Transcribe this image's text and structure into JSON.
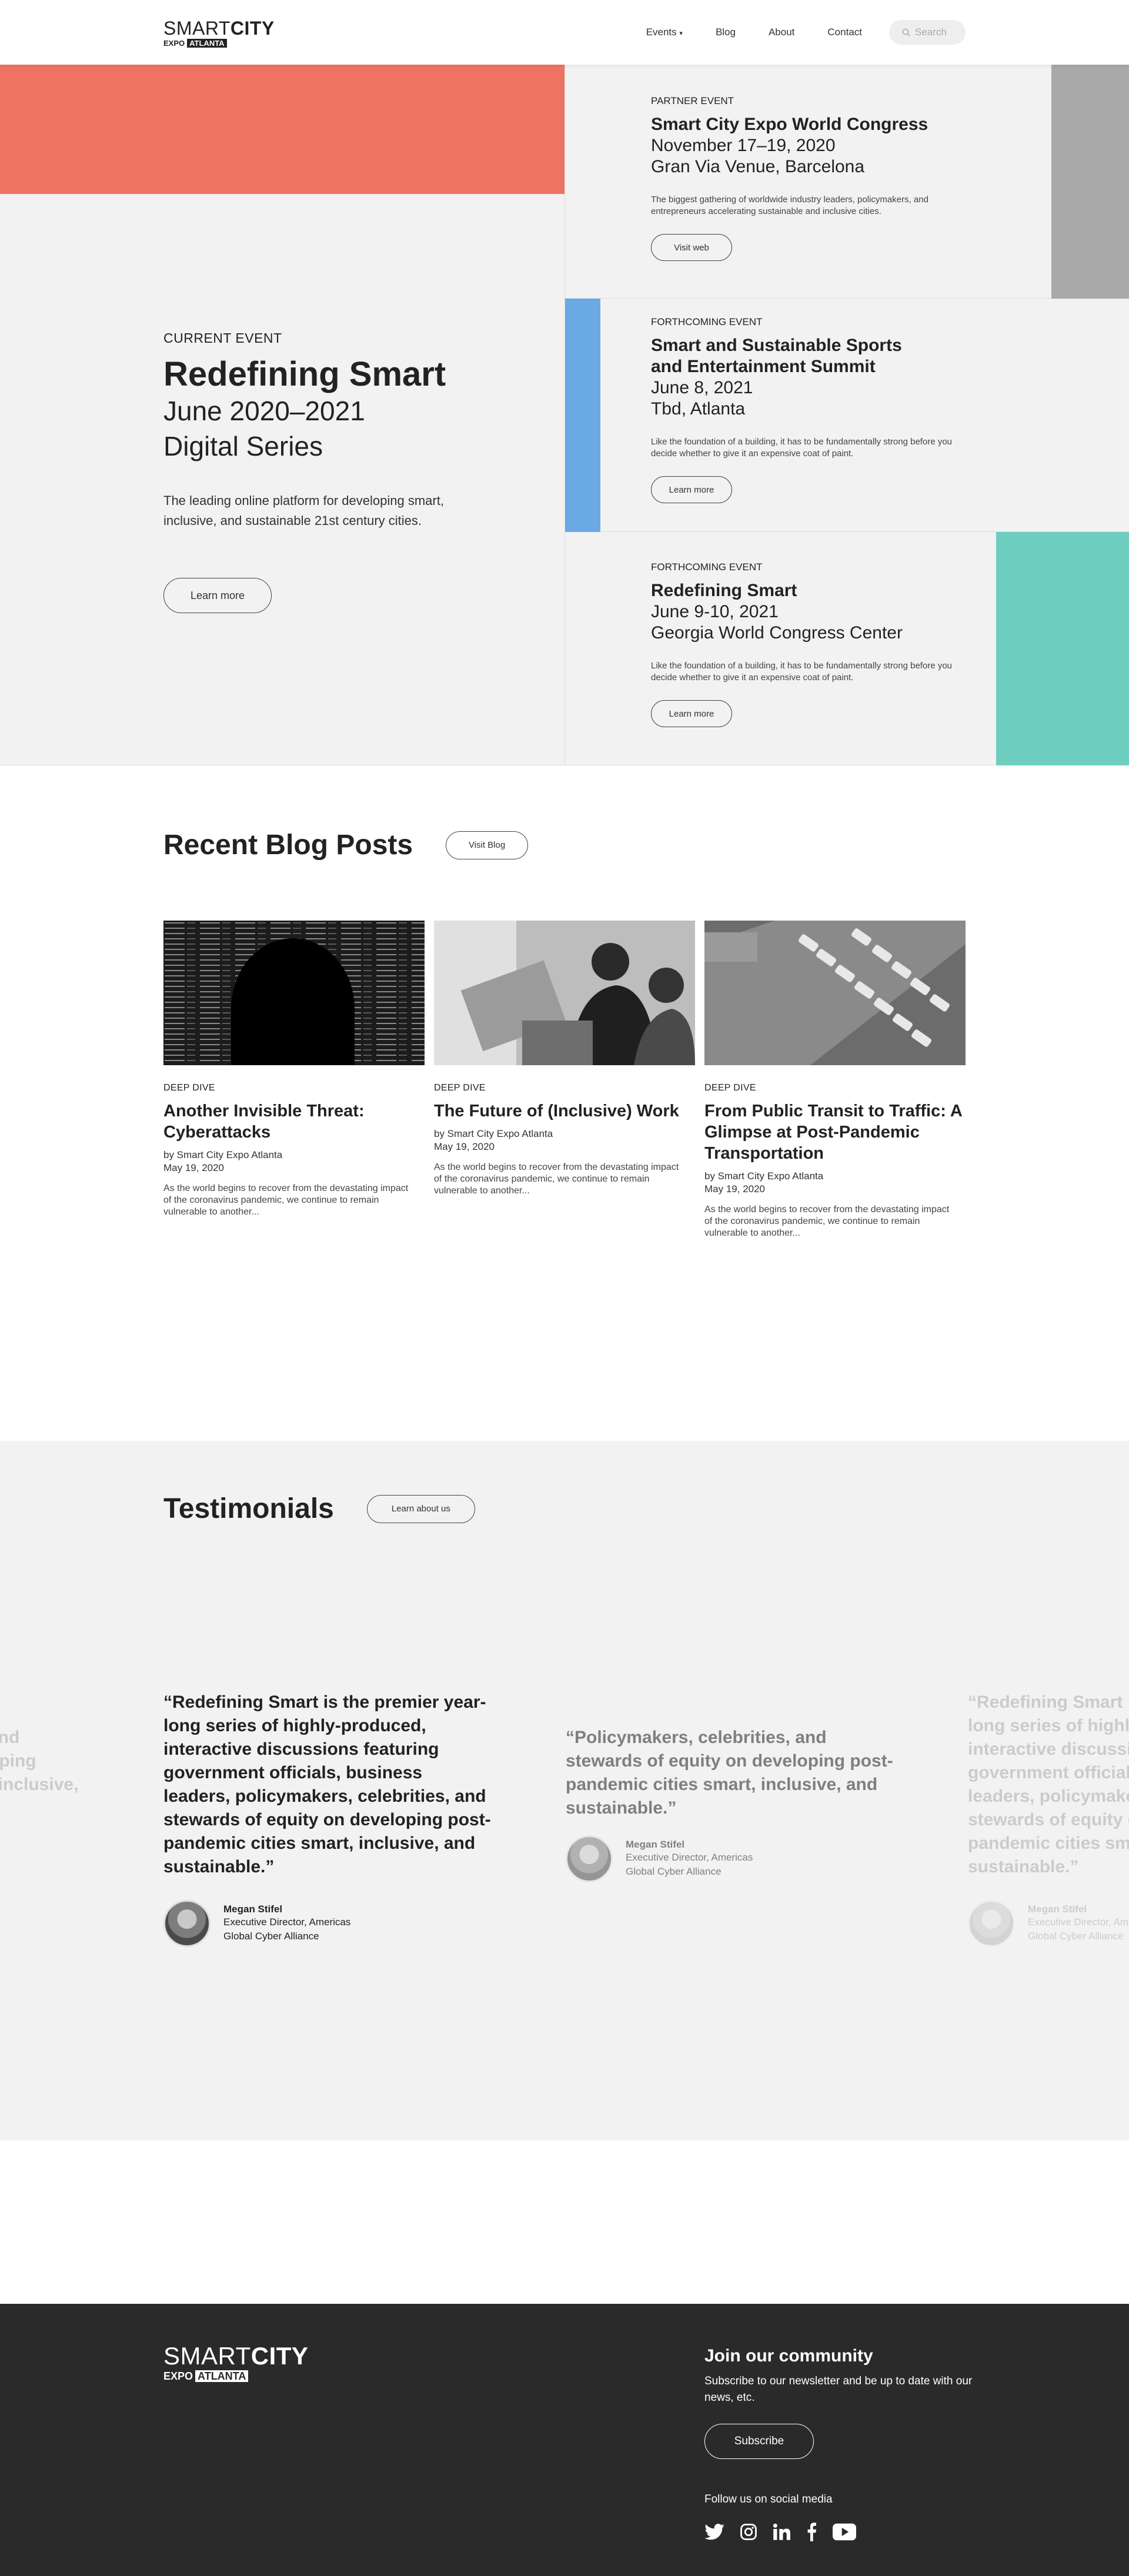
{
  "header": {
    "logo": {
      "smart": "SMART",
      "city": "CITY",
      "expo": "EXPO",
      "atlanta": "ATLANTA"
    },
    "nav": {
      "events": "Events",
      "blog": "Blog",
      "about": "About",
      "contact": "Contact"
    },
    "search_placeholder": "Search"
  },
  "hero": {
    "eyebrow": "CURRENT EVENT",
    "title": "Redefining Smart",
    "date_line1": "June 2020–2021",
    "date_line2": "Digital Series",
    "description": "The leading online platform for developing smart, inclusive, and sustainable 21st century cities.",
    "button": "Learn more",
    "colors": {
      "coral": "#ee7363",
      "gray": "#a9a9a9",
      "blue": "#6aa9e4",
      "teal": "#6dcdbe"
    }
  },
  "events": [
    {
      "kind": "PARTNER EVENT",
      "title": "Smart City Expo World Congress",
      "line1": "November 17–19, 2020",
      "line2": "Gran Via Venue, Barcelona",
      "text": "The biggest gathering of worldwide industry leaders, policymakers, and entrepreneurs accelerating sustainable and inclusive cities.",
      "button": "Visit web"
    },
    {
      "kind": "FORTHCOMING EVENT",
      "title": "Smart and Sustainable Sports and Entertainment Summit",
      "line1": "June 8, 2021",
      "line2": "Tbd, Atlanta",
      "text": "Like the foundation of a building, it has to be fundamentally strong before you decide whether to give it an expensive coat of paint.",
      "button": "Learn more"
    },
    {
      "kind": "FORTHCOMING EVENT",
      "title": "Redefining Smart",
      "line1": "June 9-10, 2021",
      "line2": "Georgia World Congress Center",
      "text": "Like the foundation of a building, it has to be fundamentally strong before you decide whether to give it an expensive coat of paint.",
      "button": "Learn more"
    }
  ],
  "blog": {
    "heading": "Recent Blog Posts",
    "button": "Visit Blog",
    "posts": [
      {
        "category": "DEEP DIVE",
        "title": "Another Invisible Threat: Cyberattacks",
        "author": "by Smart City Expo Atlanta",
        "date": "May 19, 2020",
        "excerpt": "As the world begins to recover from the devastating impact of the coronavirus pandemic, we continue to remain vulnerable to another..."
      },
      {
        "category": "DEEP DIVE",
        "title": "The Future of (Inclusive) Work",
        "author": "by Smart City Expo Atlanta",
        "date": "May 19, 2020",
        "excerpt": "As the world begins to recover from the devastating impact of the coronavirus pandemic, we continue to remain vulnerable to another..."
      },
      {
        "category": "DEEP DIVE",
        "title": "From Public Transit to Traffic: A Glimpse at Post-Pandemic Transportation",
        "author": "by Smart City Expo Atlanta",
        "date": "May 19, 2020",
        "excerpt": "As the world begins to recover from the devastating impact of the coronavirus pandemic, we continue to remain vulnerable to another..."
      }
    ]
  },
  "testimonials": {
    "heading": "Testimonials",
    "button": "Learn about us",
    "left_partial": "and\noping\n, inclusive,",
    "main": {
      "quote": "“Redefining Smart is the premier year-long series of highly-produced, interactive discussions featuring government officials, business leaders, policymakers, celebrities, and stewards of equity on developing post-pandemic cities smart, inclusive, and sustainable.”",
      "name": "Megan Stifel",
      "role1": "Executive Director, Americas",
      "role2": "Global Cyber Alliance"
    },
    "second": {
      "quote": "“Policymakers, celebrities, and stewards of equity on developing post-pandemic cities smart, inclusive, and sustainable.”",
      "name": "Megan Stifel",
      "role1": "Executive Director, Americas",
      "role2": "Global Cyber Alliance"
    },
    "third": {
      "quote": "“Redefining Smart is the premier year-long series of highly-produced, interactive discussions featuring government officials, business leaders, policymakers, celebrities, and stewards of equity on developing post-pandemic cities smart, inclusive, and sustainable.”",
      "name": "Megan Stifel",
      "role1": "Executive Director, Americas",
      "role2": "Global Cyber Alliance"
    }
  },
  "footer": {
    "join_title": "Join our community",
    "join_text": "Subscribe to our newsletter and be up to date with our news, etc.",
    "subscribe": "Subscribe",
    "follow": "Follow us on social media",
    "social": [
      "twitter-icon",
      "instagram-icon",
      "linkedin-icon",
      "facebook-icon",
      "youtube-icon"
    ]
  }
}
